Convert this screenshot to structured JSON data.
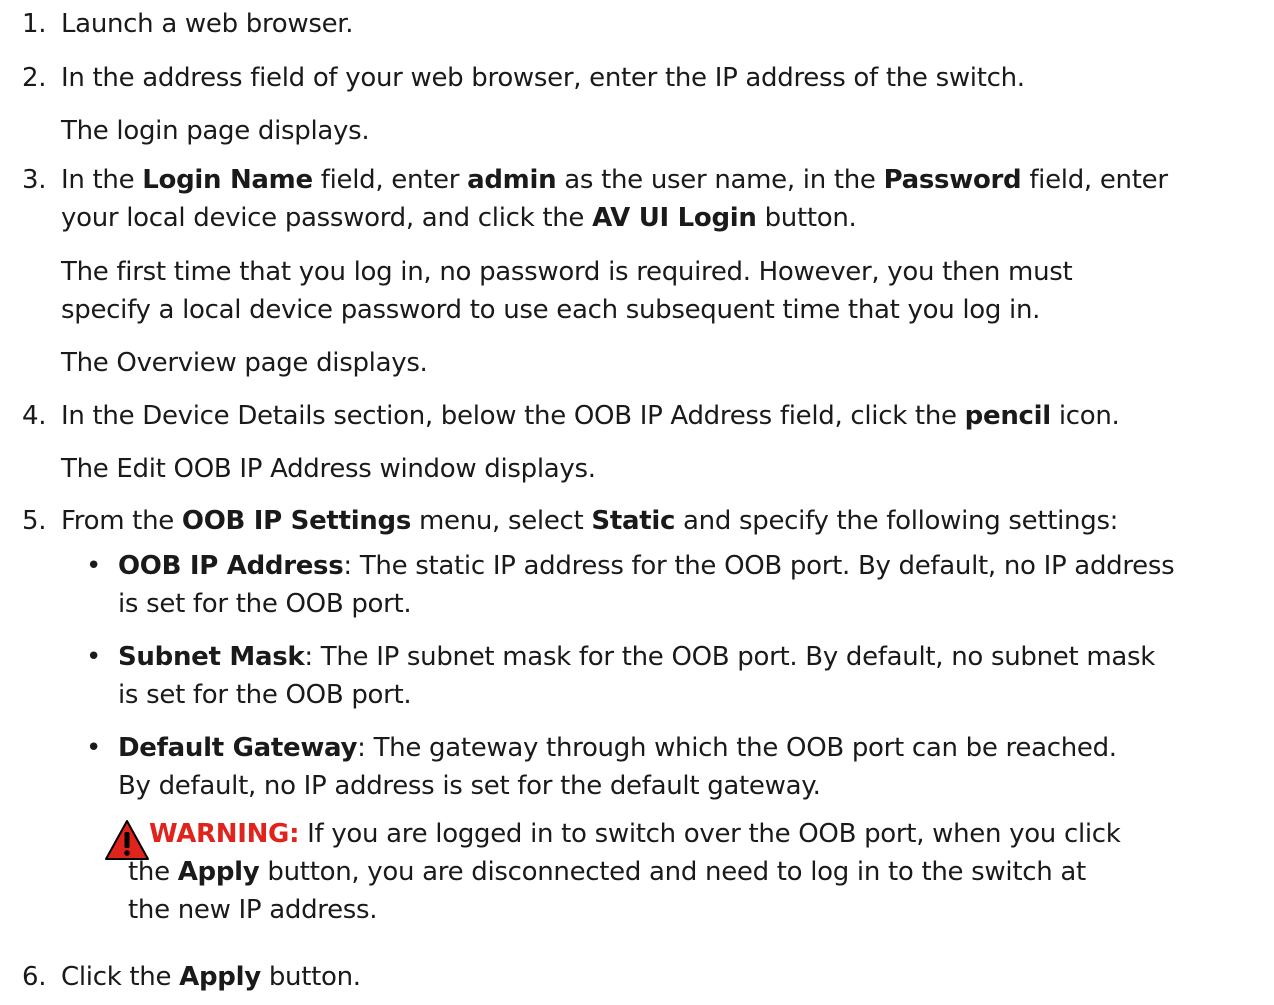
{
  "steps": [
    {
      "number": "1.",
      "text": "Launch a web browser."
    },
    {
      "number": "2.",
      "text": "In the address field of your web browser, enter the IP address of the switch.",
      "note": "The login page displays."
    },
    {
      "number": "3.",
      "parts": {
        "p1": "In the ",
        "b1": "Login Name",
        "p2": " field, enter ",
        "b2": "admin",
        "p3": " as the user name, in the ",
        "b3": "Password",
        "p4": " field, enter",
        "p5": "your local device password, and click the ",
        "b4": "AV UI Login",
        "p6": " button."
      },
      "note1_line1": "The first time that you log in, no password is required. However, you then must",
      "note1_line2": "specify a local device password to use each subsequent time that you log in.",
      "note2": "The Overview page displays."
    },
    {
      "number": "4.",
      "parts": {
        "p1": "In the Device Details section, below the OOB IP Address field, click the ",
        "b1": "pencil",
        "p2": " icon."
      },
      "note": "The Edit OOB IP Address window displays."
    },
    {
      "number": "5.",
      "parts": {
        "p1": "From the ",
        "b1": "OOB IP Settings",
        "p2": " menu, select ",
        "b2": "Static",
        "p3": " and specify the following settings:"
      },
      "bullets": [
        {
          "term": "OOB IP Address",
          "line1": ": The static IP address for the OOB port. By default, no IP address",
          "line2": "is set for the OOB port."
        },
        {
          "term": "Subnet Mask",
          "line1": ": The IP subnet mask for the OOB port. By default, no subnet mask",
          "line2": "is set for the OOB port."
        },
        {
          "term": "Default Gateway",
          "line1": ": The gateway through which the OOB port can be reached.",
          "line2": "By default, no IP address is set for the default gateway."
        }
      ],
      "warning": {
        "label": "WARNING:",
        "line1": "  If you are logged in to switch over the OOB port, when you click",
        "line2_p1": "the ",
        "line2_b": "Apply",
        "line2_p2": " button, you are disconnected and need to log in to the switch at",
        "line3": "the new IP address."
      }
    },
    {
      "number": "6.",
      "parts": {
        "p1": "Click the ",
        "b1": "Apply",
        "p2": " button."
      }
    }
  ],
  "colors": {
    "text": "#1a1a1a",
    "warning_red": "#e0231c",
    "warning_icon_fill": "#e0231c"
  }
}
